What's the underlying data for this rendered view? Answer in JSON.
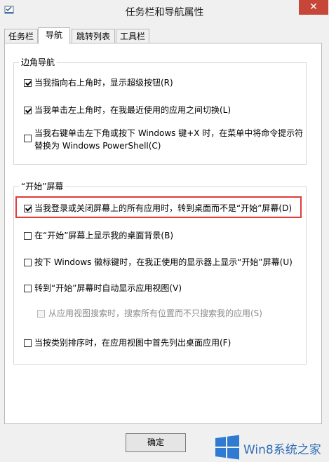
{
  "window": {
    "title": "任务栏和导航属性",
    "close_glyph": "✕"
  },
  "tabs": [
    {
      "label": "任务栏"
    },
    {
      "label": "导航"
    },
    {
      "label": "跳转列表"
    },
    {
      "label": "工具栏"
    }
  ],
  "corner_nav": {
    "title": "边角导航",
    "options": [
      {
        "label": "当我指向右上角时，显示超级按钮(R)",
        "checked": true
      },
      {
        "label": "当我单击左上角时，在我最近使用的应用之间切换(L)",
        "checked": true
      },
      {
        "label_line1": "当我右键单击左下角或按下 Windows 键+X 时，在菜单中将命令提示符",
        "label_line2": "替换为 Windows PowerShell(C)",
        "checked": false
      }
    ]
  },
  "start_screen": {
    "title": "“开始”屏幕",
    "options": [
      {
        "label": "当我登录或关闭屏幕上的所有应用时，转到桌面而不是“开始”屏幕(D)",
        "checked": true
      },
      {
        "label": "在“开始”屏幕上显示我的桌面背景(B)",
        "checked": false
      },
      {
        "label": "按下 Windows 徽标键时，在我正使用的显示器上显示“开始”屏幕(U)",
        "checked": false
      },
      {
        "label": "转到“开始”屏幕时自动显示应用视图(V)",
        "checked": false
      },
      {
        "label": "从应用视图搜索时，搜索所有位置而不只搜索我的应用(S)",
        "checked": false,
        "disabled": true
      },
      {
        "label": "当按类别排序时，在应用视图中首先列出桌面应用(F)",
        "checked": false
      }
    ]
  },
  "buttons": {
    "ok_label": "确定"
  },
  "watermark": {
    "text": "Win8系统之家"
  },
  "colors": {
    "highlight_border": "#e23b3b",
    "close_button": "#c7463a",
    "watermark_blue": "#2f6db5"
  }
}
